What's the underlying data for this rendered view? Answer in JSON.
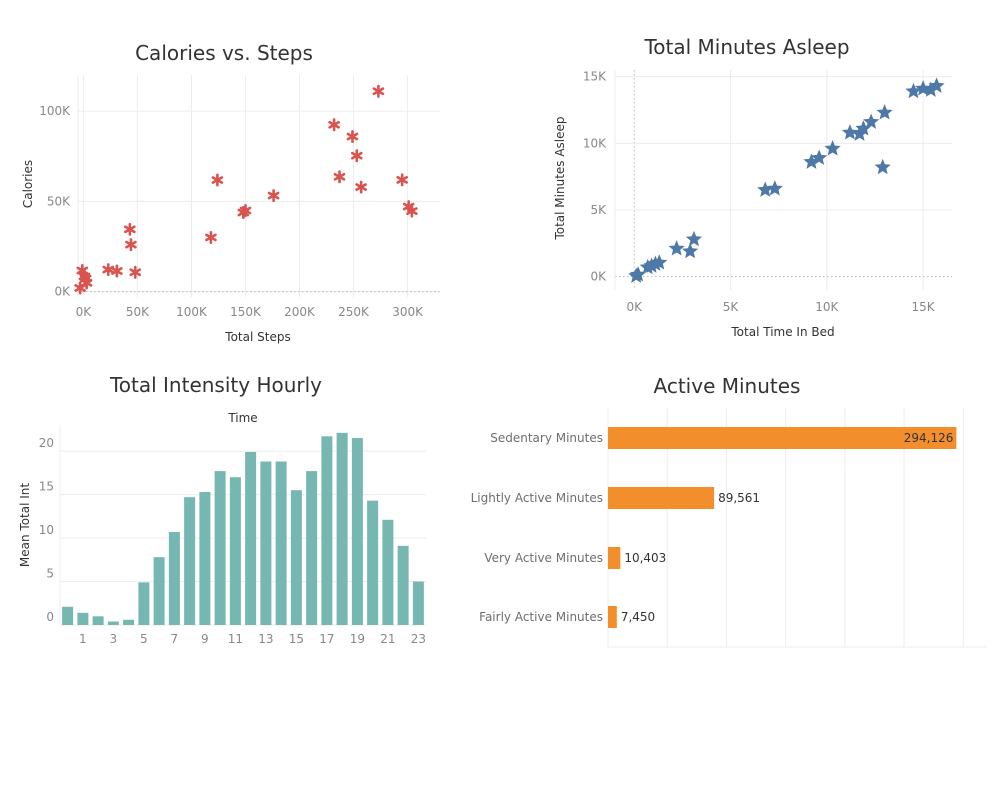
{
  "chart_data": [
    {
      "id": "calories_vs_steps",
      "type": "scatter",
      "title": "Calories vs. Steps",
      "xlabel": "Total Steps",
      "ylabel": "Calories",
      "xlim": [
        -5000,
        330000
      ],
      "ylim": [
        -3000,
        120000
      ],
      "xticks": [
        0,
        50000,
        100000,
        150000,
        200000,
        250000,
        300000
      ],
      "xtick_labels": [
        "0K",
        "50K",
        "100K",
        "150K",
        "200K",
        "250K",
        "300K"
      ],
      "yticks": [
        0,
        50000,
        100000
      ],
      "ytick_labels": [
        "0K",
        "50K",
        "100K"
      ],
      "marker": "asterisk",
      "color": "#d9534f",
      "points": [
        [
          -3000,
          2000
        ],
        [
          -1000,
          11700
        ],
        [
          1000,
          8400
        ],
        [
          3000,
          4800
        ],
        [
          2000,
          7100
        ],
        [
          23000,
          12200
        ],
        [
          31000,
          11400
        ],
        [
          43000,
          34500
        ],
        [
          44000,
          26000
        ],
        [
          48000,
          10700
        ],
        [
          118000,
          30000
        ],
        [
          124000,
          61800
        ],
        [
          148000,
          43800
        ],
        [
          150000,
          44900
        ],
        [
          176000,
          53200
        ],
        [
          232000,
          92400
        ],
        [
          237000,
          63600
        ],
        [
          249000,
          85900
        ],
        [
          253000,
          75300
        ],
        [
          257000,
          57900
        ],
        [
          273000,
          111000
        ],
        [
          295000,
          61900
        ],
        [
          301000,
          47100
        ],
        [
          304000,
          44600
        ]
      ]
    },
    {
      "id": "total_minutes_asleep",
      "type": "scatter",
      "title": "Total Minutes Asleep",
      "xlabel": "Total Time In Bed",
      "ylabel": "Total Minutes Asleep",
      "xlim": [
        -1000,
        16500
      ],
      "ylim": [
        -1000,
        15500
      ],
      "xticks": [
        0,
        5000,
        10000,
        15000
      ],
      "xtick_labels": [
        "0K",
        "5K",
        "10K",
        "15K"
      ],
      "yticks": [
        0,
        5000,
        10000,
        15000
      ],
      "ytick_labels": [
        "0K",
        "5K",
        "10K",
        "15K"
      ],
      "marker": "star",
      "color": "#4e79a7",
      "points": [
        [
          100,
          50
        ],
        [
          200,
          150
        ],
        [
          700,
          700
        ],
        [
          900,
          800
        ],
        [
          1100,
          950
        ],
        [
          1300,
          1050
        ],
        [
          2200,
          2100
        ],
        [
          2900,
          1900
        ],
        [
          3100,
          2800
        ],
        [
          6800,
          6500
        ],
        [
          7300,
          6600
        ],
        [
          9200,
          8600
        ],
        [
          9600,
          8900
        ],
        [
          10300,
          9600
        ],
        [
          11200,
          10800
        ],
        [
          11700,
          10700
        ],
        [
          11900,
          11100
        ],
        [
          12300,
          11600
        ],
        [
          13000,
          12300
        ],
        [
          12900,
          8200
        ],
        [
          14500,
          13900
        ],
        [
          15000,
          14100
        ],
        [
          15400,
          14000
        ],
        [
          15700,
          14300
        ]
      ]
    },
    {
      "id": "total_intensity_hourly",
      "type": "bar",
      "title": "Total Intensity Hourly",
      "xlabel": "Time",
      "ylabel": "Mean Total Int",
      "ylim": [
        0,
        23
      ],
      "yticks": [
        0,
        5,
        10,
        15,
        20
      ],
      "xtick_labels": [
        "1",
        "3",
        "5",
        "7",
        "9",
        "11",
        "13",
        "15",
        "17",
        "19",
        "21",
        "23"
      ],
      "color": "#76b7b2",
      "categories": [
        0,
        1,
        2,
        3,
        4,
        5,
        6,
        7,
        8,
        9,
        10,
        11,
        12,
        13,
        14,
        15,
        16,
        17,
        18,
        19,
        20,
        21,
        22,
        23
      ],
      "values": [
        2.1,
        1.4,
        1.0,
        0.4,
        0.6,
        4.9,
        7.8,
        10.7,
        14.7,
        15.3,
        17.7,
        17.0,
        19.9,
        18.8,
        18.8,
        15.5,
        17.7,
        21.7,
        22.1,
        21.5,
        14.3,
        12.1,
        9.1,
        5.0
      ]
    },
    {
      "id": "active_minutes",
      "type": "bar",
      "orientation": "horizontal",
      "title": "Active Minutes",
      "color": "#f28e2b",
      "xlim": [
        0,
        320000
      ],
      "categories": [
        "Sedentary Minutes",
        "Lightly Active Minutes",
        "Very Active Minutes",
        "Fairly Active Minutes"
      ],
      "values": [
        294126,
        89561,
        10403,
        7450
      ],
      "value_labels": [
        "294,126",
        "89,561",
        "10,403",
        "7,450"
      ]
    }
  ]
}
